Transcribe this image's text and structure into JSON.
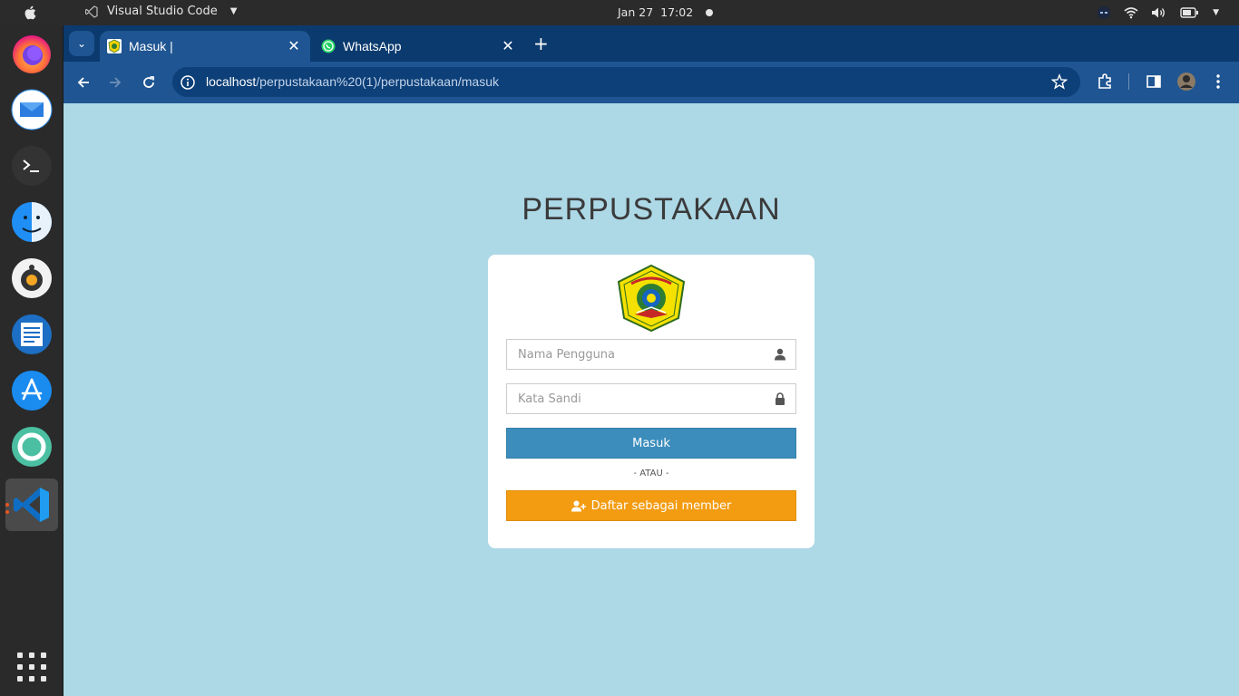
{
  "system_bar": {
    "app_name": "Visual Studio Code",
    "date": "Jan 27",
    "time": "17:02"
  },
  "dock": {
    "items": [
      "firefox-icon",
      "mail-icon",
      "terminal-icon",
      "finder-icon",
      "speaker-icon",
      "text-editor-icon",
      "app-store-icon",
      "help-icon",
      "vscode-icon"
    ],
    "active": "vscode-icon"
  },
  "browser": {
    "tabs": [
      {
        "title": "Masuk |",
        "active": true,
        "favicon": "school-logo-icon"
      },
      {
        "title": "WhatsApp",
        "active": false,
        "favicon": "whatsapp-icon"
      }
    ],
    "url_host": "localhost",
    "url_path": "/perpustakaan%20(1)/perpustakaan/masuk",
    "colors": {
      "tabstrip": "#0b3a6e",
      "toolbar": "#1e5592"
    }
  },
  "page": {
    "heading": "PERPUSTAKAAN",
    "username_placeholder": "Nama Pengguna",
    "password_placeholder": "Kata Sandi",
    "login_label": "Masuk",
    "or_label": "- ATAU -",
    "register_label": "Daftar sebagai member",
    "colors": {
      "background": "#add8e6",
      "login": "#3c8dbc",
      "register": "#f39c12"
    }
  }
}
